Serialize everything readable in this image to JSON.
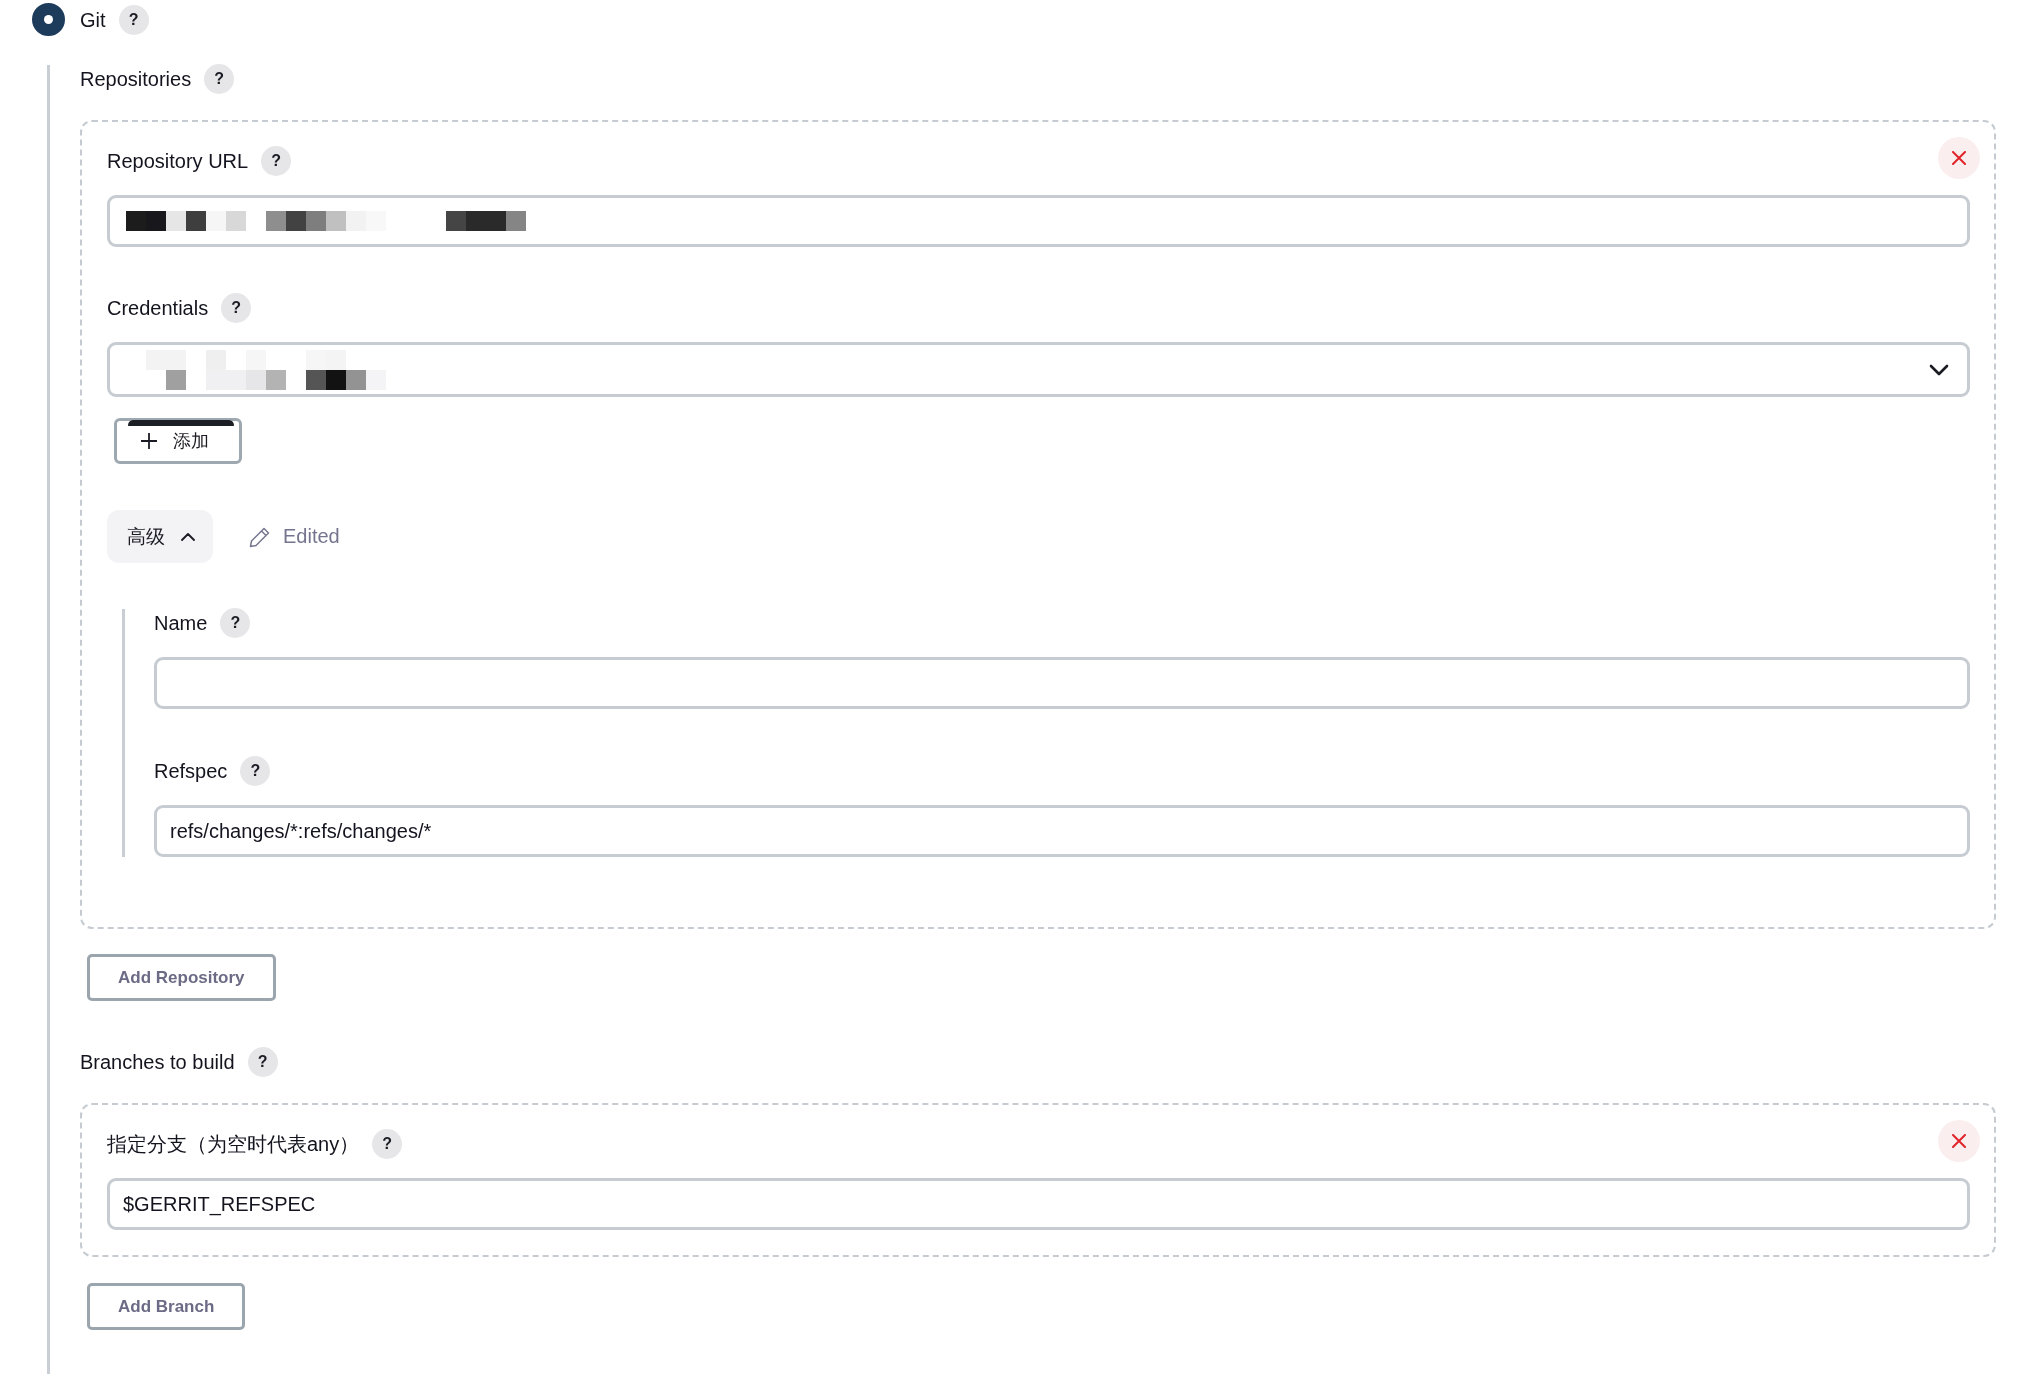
{
  "scm": {
    "label": "Git",
    "help": "?",
    "selected": true
  },
  "repositories": {
    "label": "Repositories",
    "help": "?",
    "items": [
      {
        "fields": [
          {
            "kind": "text",
            "label": "Repository URL",
            "help": "?",
            "redacted": true
          },
          {
            "kind": "select",
            "label": "Credentials",
            "help": "?",
            "redacted": true,
            "add_button": "添加"
          }
        ],
        "advanced": {
          "label": "高级",
          "expanded": true,
          "status": "Edited",
          "fields": [
            {
              "kind": "text",
              "label": "Name",
              "help": "?"
            },
            {
              "kind": "text",
              "label": "Refspec",
              "help": "?",
              "value": "refs/changes/*:refs/changes/*"
            }
          ]
        }
      }
    ],
    "add_button": "Add Repository"
  },
  "branches": {
    "label": "Branches to build",
    "help": "?",
    "items": [
      {
        "fields": [
          {
            "kind": "text",
            "label": "指定分支（为空时代表any）",
            "help": "?",
            "value": "$GERRIT_REFSPEC"
          }
        ]
      }
    ],
    "add_button": "Add Branch"
  }
}
